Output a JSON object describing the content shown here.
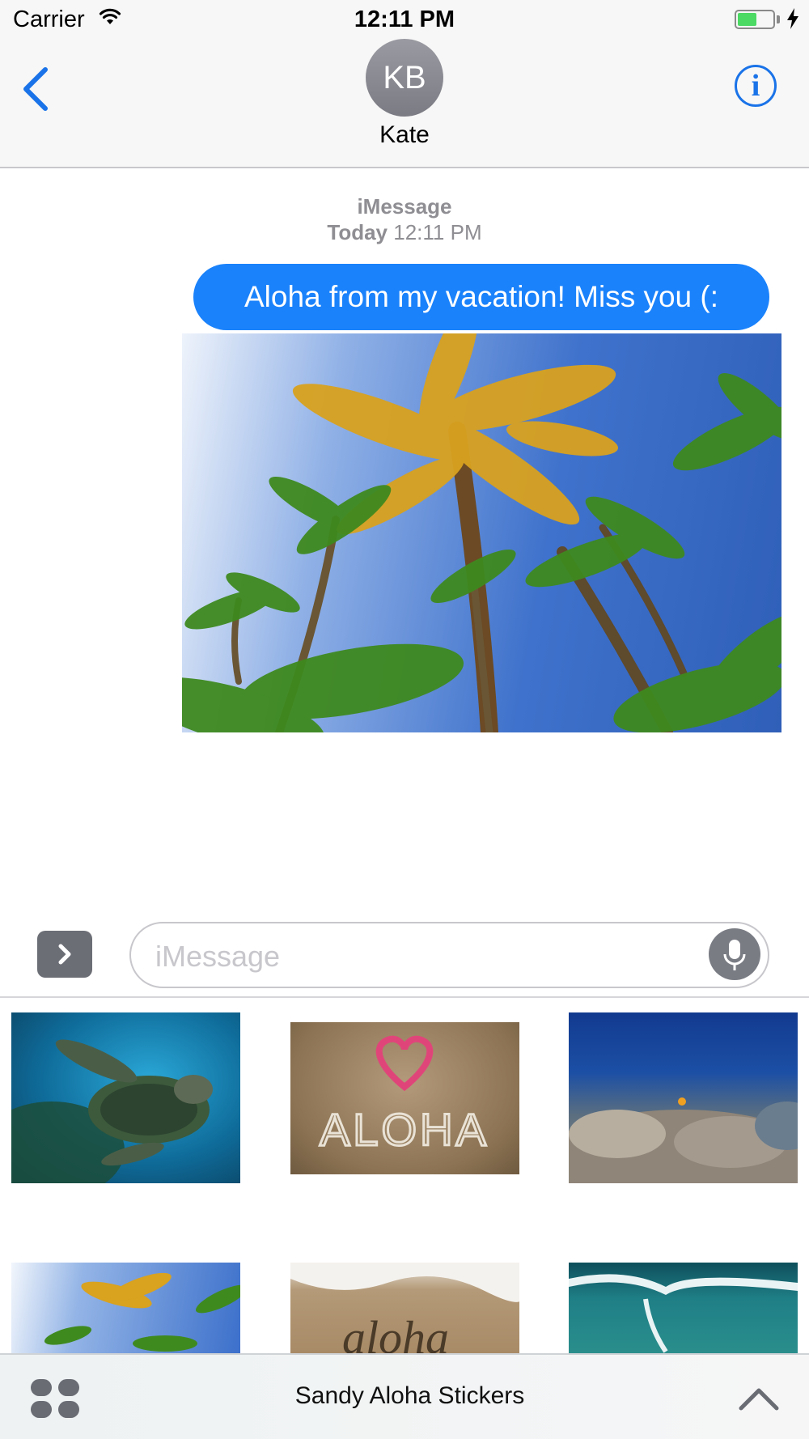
{
  "status_bar": {
    "carrier": "Carrier",
    "time": "12:11 PM",
    "battery_level": 0.55,
    "icons": [
      "wifi-icon",
      "battery-icon",
      "charging-bolt-icon"
    ]
  },
  "header": {
    "avatar_initials": "KB",
    "contact_name": "Kate",
    "icons": [
      "back-chevron-icon",
      "info-icon"
    ],
    "info_glyph": "i"
  },
  "conversation": {
    "service_label": "iMessage",
    "timestamp_day": "Today",
    "timestamp_time": "12:11 PM",
    "message_text": "Aloha from my vacation! Miss you (:"
  },
  "input_bar": {
    "placeholder": "iMessage",
    "icons": [
      "chevron-right-icon",
      "microphone-icon"
    ]
  },
  "app_drawer": {
    "app_name": "Sandy Aloha Stickers",
    "icons": [
      "app-grid-icon",
      "chevron-up-icon"
    ],
    "sticker_text": {
      "sand": "ALOHA",
      "beach": "aloha"
    }
  },
  "colors": {
    "accent": "#1a82fb",
    "link": "#1a73e8",
    "battery": "#4cd964"
  }
}
